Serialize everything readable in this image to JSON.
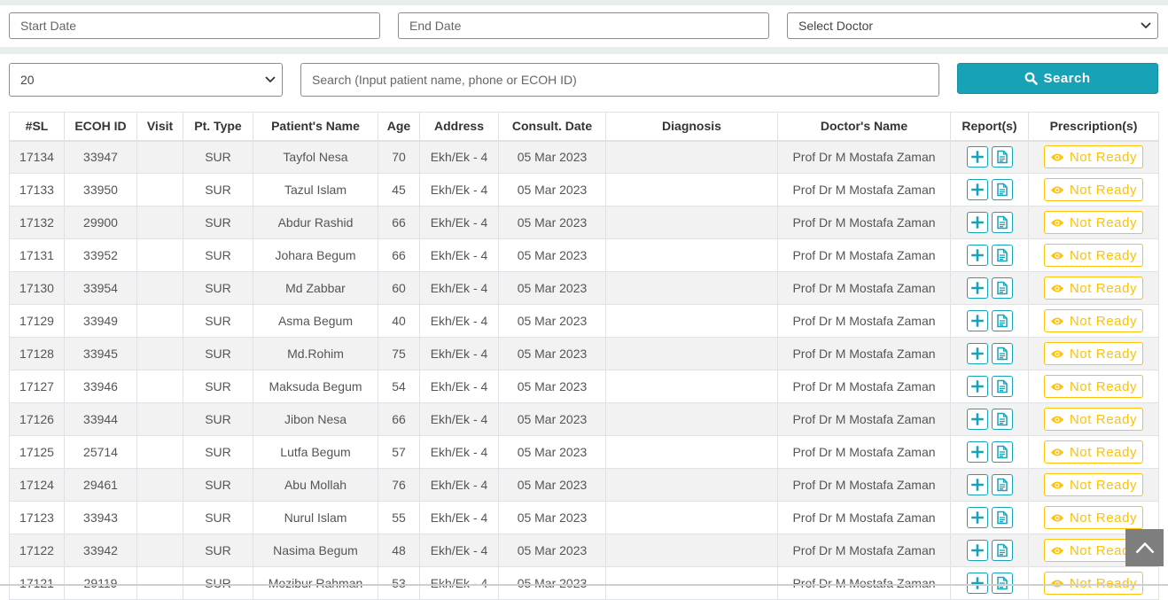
{
  "filters": {
    "start_date_placeholder": "Start Date",
    "end_date_placeholder": "End Date",
    "doctor_select_value": "Select Doctor"
  },
  "search_bar": {
    "page_size_value": "20",
    "search_placeholder": "Search (Input patient name, phone or ECOH ID)",
    "search_button_label": "Search"
  },
  "colors": {
    "accent": "#17a2b8",
    "warning": "#ffc107",
    "stripe": "#f2f2f2"
  },
  "table": {
    "headers": [
      "#SL",
      "ECOH ID",
      "Visit",
      "Pt. Type",
      "Patient's Name",
      "Age",
      "Address",
      "Consult. Date",
      "Diagnosis",
      "Doctor's Name",
      "Report(s)",
      "Prescription(s)"
    ],
    "not_ready_label": "Not Ready",
    "rows": [
      {
        "sl": "17134",
        "ecoh": "33947",
        "visit": "",
        "type": "SUR",
        "name": "Tayfol Nesa",
        "age": "70",
        "address": "Ekh/Ek - 4",
        "date": "05 Mar 2023",
        "diagnosis": "",
        "doctor": "Prof Dr M Mostafa Zaman"
      },
      {
        "sl": "17133",
        "ecoh": "33950",
        "visit": "",
        "type": "SUR",
        "name": "Tazul Islam",
        "age": "45",
        "address": "Ekh/Ek - 4",
        "date": "05 Mar 2023",
        "diagnosis": "",
        "doctor": "Prof Dr M Mostafa Zaman"
      },
      {
        "sl": "17132",
        "ecoh": "29900",
        "visit": "",
        "type": "SUR",
        "name": "Abdur Rashid",
        "age": "66",
        "address": "Ekh/Ek - 4",
        "date": "05 Mar 2023",
        "diagnosis": "",
        "doctor": "Prof Dr M Mostafa Zaman"
      },
      {
        "sl": "17131",
        "ecoh": "33952",
        "visit": "",
        "type": "SUR",
        "name": "Johara Begum",
        "age": "66",
        "address": "Ekh/Ek - 4",
        "date": "05 Mar 2023",
        "diagnosis": "",
        "doctor": "Prof Dr M Mostafa Zaman"
      },
      {
        "sl": "17130",
        "ecoh": "33954",
        "visit": "",
        "type": "SUR",
        "name": "Md Zabbar",
        "age": "60",
        "address": "Ekh/Ek - 4",
        "date": "05 Mar 2023",
        "diagnosis": "",
        "doctor": "Prof Dr M Mostafa Zaman"
      },
      {
        "sl": "17129",
        "ecoh": "33949",
        "visit": "",
        "type": "SUR",
        "name": "Asma Begum",
        "age": "40",
        "address": "Ekh/Ek - 4",
        "date": "05 Mar 2023",
        "diagnosis": "",
        "doctor": "Prof Dr M Mostafa Zaman"
      },
      {
        "sl": "17128",
        "ecoh": "33945",
        "visit": "",
        "type": "SUR",
        "name": "Md.Rohim",
        "age": "75",
        "address": "Ekh/Ek - 4",
        "date": "05 Mar 2023",
        "diagnosis": "",
        "doctor": "Prof Dr M Mostafa Zaman"
      },
      {
        "sl": "17127",
        "ecoh": "33946",
        "visit": "",
        "type": "SUR",
        "name": "Maksuda Begum",
        "age": "54",
        "address": "Ekh/Ek - 4",
        "date": "05 Mar 2023",
        "diagnosis": "",
        "doctor": "Prof Dr M Mostafa Zaman"
      },
      {
        "sl": "17126",
        "ecoh": "33944",
        "visit": "",
        "type": "SUR",
        "name": "Jibon Nesa",
        "age": "66",
        "address": "Ekh/Ek - 4",
        "date": "05 Mar 2023",
        "diagnosis": "",
        "doctor": "Prof Dr M Mostafa Zaman"
      },
      {
        "sl": "17125",
        "ecoh": "25714",
        "visit": "",
        "type": "SUR",
        "name": "Lutfa Begum",
        "age": "57",
        "address": "Ekh/Ek - 4",
        "date": "05 Mar 2023",
        "diagnosis": "",
        "doctor": "Prof Dr M Mostafa Zaman"
      },
      {
        "sl": "17124",
        "ecoh": "29461",
        "visit": "",
        "type": "SUR",
        "name": "Abu Mollah",
        "age": "76",
        "address": "Ekh/Ek - 4",
        "date": "05 Mar 2023",
        "diagnosis": "",
        "doctor": "Prof Dr M Mostafa Zaman"
      },
      {
        "sl": "17123",
        "ecoh": "33943",
        "visit": "",
        "type": "SUR",
        "name": "Nurul Islam",
        "age": "55",
        "address": "Ekh/Ek - 4",
        "date": "05 Mar 2023",
        "diagnosis": "",
        "doctor": "Prof Dr M Mostafa Zaman"
      },
      {
        "sl": "17122",
        "ecoh": "33942",
        "visit": "",
        "type": "SUR",
        "name": "Nasima Begum",
        "age": "48",
        "address": "Ekh/Ek - 4",
        "date": "05 Mar 2023",
        "diagnosis": "",
        "doctor": "Prof Dr M Mostafa Zaman"
      },
      {
        "sl": "17121",
        "ecoh": "29119",
        "visit": "",
        "type": "SUR",
        "name": "Mozibur Rahman",
        "age": "53",
        "address": "Ekh/Ek - 4",
        "date": "05 Mar 2023",
        "diagnosis": "",
        "doctor": "Prof Dr M Mostafa Zaman"
      }
    ]
  }
}
